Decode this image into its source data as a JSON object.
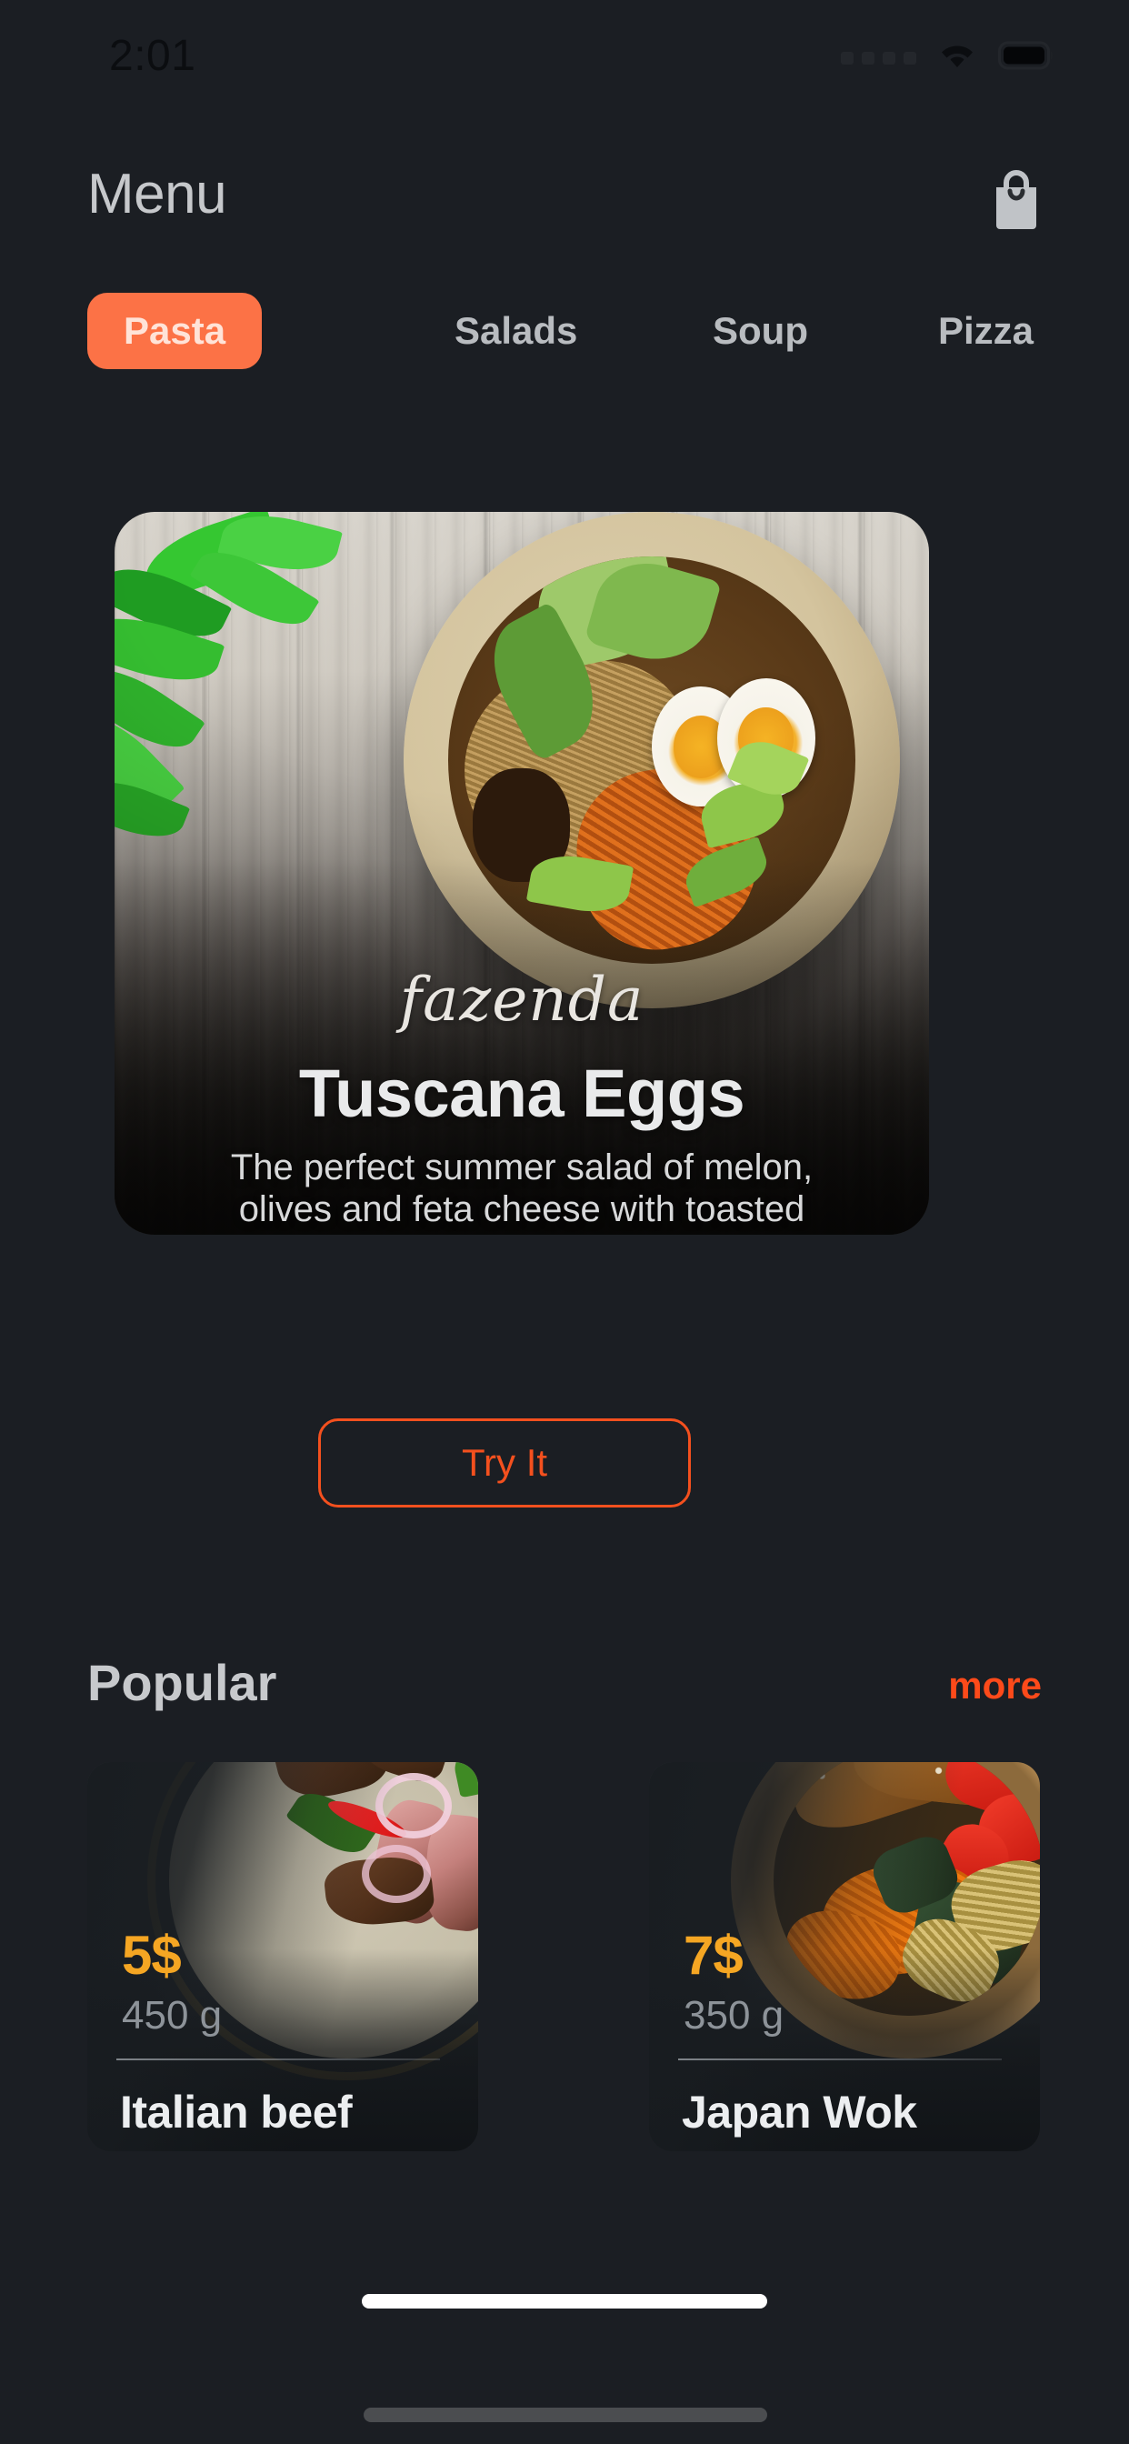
{
  "statusbar": {
    "time": "2:01",
    "signal_icon": "signal-dots-icon",
    "wifi_icon": "wifi-icon",
    "battery_icon": "battery-full-icon"
  },
  "header": {
    "title": "Menu",
    "cart_icon": "shopping-bag-icon"
  },
  "tabs": [
    {
      "label": "Pasta",
      "active": true
    },
    {
      "label": "Salads",
      "active": false
    },
    {
      "label": "Soup",
      "active": false
    },
    {
      "label": "Pizza",
      "active": false
    }
  ],
  "hero": {
    "brand": "fazenda",
    "name": "Tuscana Eggs",
    "description_line1": "The perfect summer salad of melon,",
    "description_line2": "olives and feta cheese with toasted",
    "cta_label": "Try It"
  },
  "popular": {
    "section_title": "Popular",
    "more_label": "more",
    "items": [
      {
        "price": "5$",
        "weight": "450 g",
        "name": "Italian beef"
      },
      {
        "price": "7$",
        "weight": "350 g",
        "name": "Japan Wok"
      }
    ]
  },
  "colors": {
    "background": "#1b1e23",
    "accent_orange": "#fc7246",
    "cta_orange": "#f4501e",
    "more_orange": "#fc4a1a",
    "price_gold": "#f5a623",
    "text_primary": "#e9eaeb",
    "text_muted": "#8d9399"
  }
}
